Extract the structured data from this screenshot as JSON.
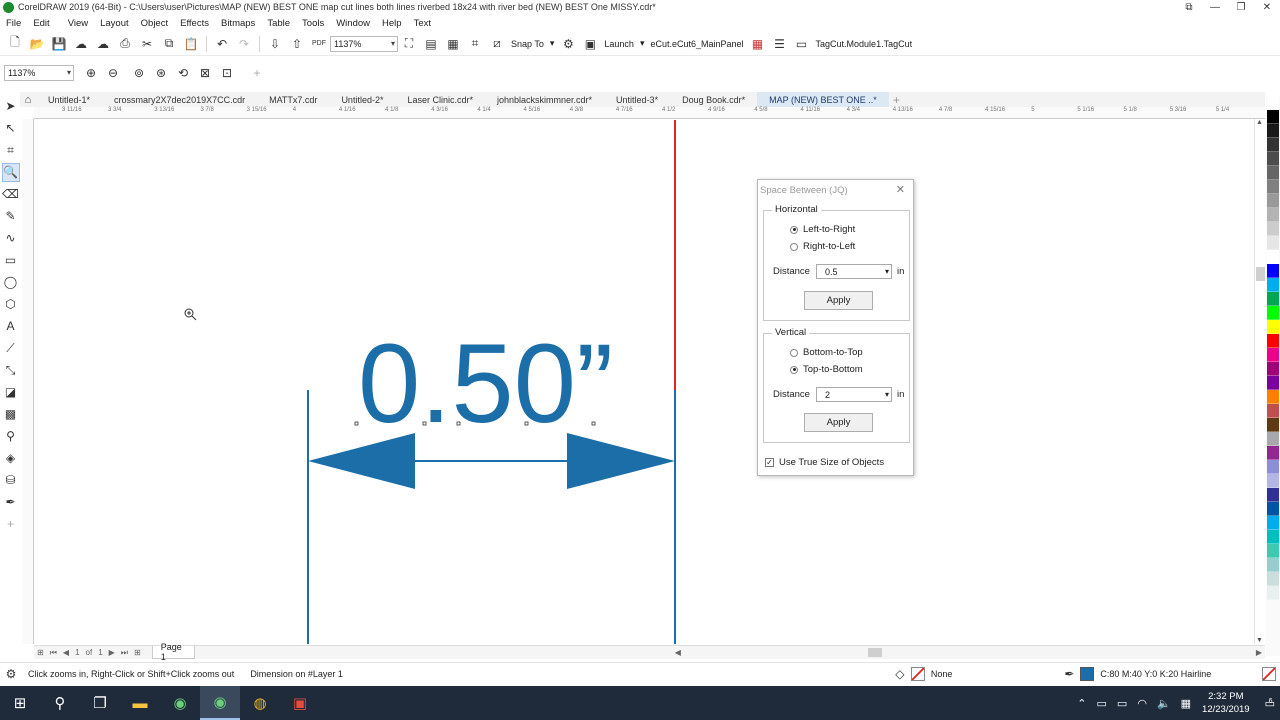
{
  "window": {
    "title": "CorelDRAW 2019 (64-Bit) - C:\\Users\\user\\Pictures\\MAP (NEW) BEST ONE map cut lines both lines  riverbed 18x24 with river bed (NEW) BEST One MISSY.cdr*",
    "controls": [
      "⧉",
      "—",
      "❐",
      "✕"
    ]
  },
  "menu": [
    "File",
    "Edit",
    "View",
    "Layout",
    "Object",
    "Effects",
    "Bitmaps",
    "Table",
    "Tools",
    "Window",
    "Help",
    "Text"
  ],
  "toolbar": {
    "zoom_value": "1137%",
    "snap_label": "Snap To",
    "launch_label": "Launch",
    "panel_label": "eCut.eCut6_MainPanel",
    "tagcut_label": "TagCut.Module1.TagCut"
  },
  "propbar": {
    "zoom_value": "1137%"
  },
  "tabs": [
    "Untitled-1*",
    "crossmary2X7dec2019X7CC.cdr",
    "MATTx7.cdr",
    "Untitled-2*",
    "Laser Clinic.cdr*",
    "johnblackskimmner.cdr*",
    "Untitled-3*",
    "Doug Book.cdr*",
    "MAP (NEW) BEST ONE ..*"
  ],
  "ruler": {
    "labels": [
      "3 11/16",
      "3 3/4",
      "3 13/16",
      "3 7/8",
      "3 15/16",
      "4",
      "4 1/16",
      "4 1/8",
      "4 3/16",
      "4 1/4",
      "4 5/16",
      "4 3/8",
      "4 7/16",
      "4 1/2",
      "4 9/16",
      "4 5/8",
      "4 11/16",
      "4 3/4",
      "4 13/16",
      "4 7/8",
      "4 15/16",
      "5",
      "5 1/16",
      "5 1/8",
      "5 3/16",
      "5 1/4"
    ],
    "units": "inches"
  },
  "canvas": {
    "dimension_text": "0.50”",
    "dimension_color": "#1c6ea8",
    "guide_color": "#e52222"
  },
  "dialog": {
    "title": "Space Between (JQ)",
    "horizontal": {
      "label": "Horizontal",
      "options": [
        "Left-to-Right",
        "Right-to-Left"
      ],
      "selected": "Left-to-Right",
      "distance_label": "Distance",
      "distance_value": "0.5",
      "unit": "in",
      "apply_label": "Apply"
    },
    "vertical": {
      "label": "Vertical",
      "options": [
        "Bottom-to-Top",
        "Top-to-Bottom"
      ],
      "selected": "Top-to-Bottom",
      "distance_label": "Distance",
      "distance_value": "2",
      "unit": "in",
      "apply_label": "Apply"
    },
    "use_true_size_label": "Use True Size of Objects",
    "use_true_size_checked": true
  },
  "pagebar": {
    "page_of": "of",
    "page_num": "1",
    "page_label": "Page 1"
  },
  "status": {
    "hint": "Click zooms in, Right-Click or Shift+Click zooms out",
    "object": "Dimension on #Layer 1",
    "fill_label": "None",
    "outline_label": "C:80 M:40 Y:0 K:20  Hairline",
    "outline_color": "#1c6ea8"
  },
  "taskbar": {
    "time": "2:32 PM",
    "date": "12/23/2019",
    "notification_count": "6"
  },
  "palette": [
    "#ffffff",
    "#000000",
    "#1a1a1a",
    "#333333",
    "#4d4d4d",
    "#666666",
    "#808080",
    "#999999",
    "#b3b3b3",
    "#cccccc",
    "#e6e6e6",
    "#ffffff",
    "#0000ff",
    "#00aeef",
    "#00a651",
    "#00ff00",
    "#ffff00",
    "#ff0000",
    "#ec008c",
    "#a0007a",
    "#7a00a0",
    "#ff8000",
    "#c0504d",
    "#603913",
    "#a7a9ac",
    "#92278f",
    "#8a8fd8",
    "#b4b6e6",
    "#2e3192",
    "#0054a6",
    "#00aeef",
    "#00c0c0",
    "#40c8b0",
    "#99cccc",
    "#ccdddd",
    "#e8f0f0"
  ]
}
